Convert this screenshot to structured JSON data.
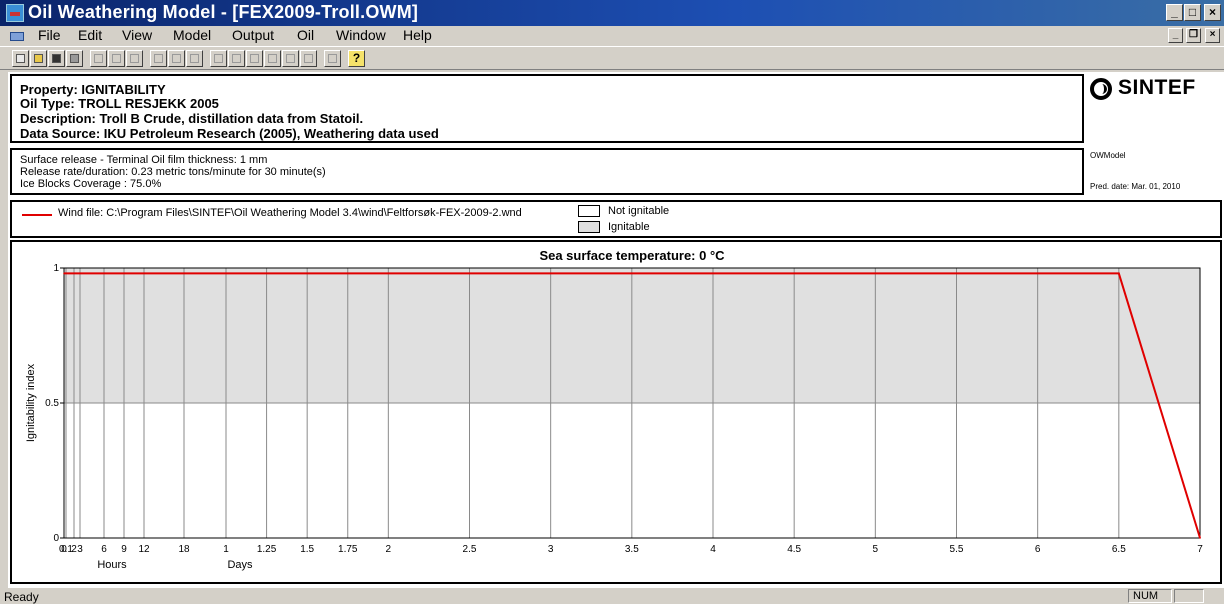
{
  "window": {
    "title": "Oil Weathering Model - [FEX2009-Troll.OWM]",
    "icon": "app-icon",
    "controls": {
      "minimize": "_",
      "maximize": "□",
      "close": "×"
    }
  },
  "menubar": {
    "items": [
      "File",
      "Edit",
      "View",
      "Model",
      "Output",
      "Oil",
      "Window",
      "Help"
    ],
    "mdi_controls": {
      "minimize": "_",
      "restore": "❐",
      "close": "×"
    }
  },
  "toolbar": {
    "buttons": [
      "new-icon",
      "open-icon",
      "save-icon",
      "print-icon",
      "cut-icon",
      "copy-icon",
      "paste-icon",
      "chart1-icon",
      "chart2-icon",
      "chart3-icon",
      "chart4-icon",
      "chart5-icon",
      "chart6-icon",
      "chart7-icon",
      "chart8-icon",
      "chart9-icon",
      "about-icon"
    ],
    "help_glyph": "?"
  },
  "header": {
    "property": "Property: IGNITABILITY",
    "oil_type": "Oil Type: TROLL RESJEKK 2005",
    "description": "Description: Troll  B Crude, distillation data from Statoil.",
    "data_source": "Data Source: IKU Petroleum Research (2005), Weathering data used",
    "brand": "SINTEF",
    "model_tag": "OWModel"
  },
  "release": {
    "line1": "Surface release - Terminal Oil film thickness: 1 mm",
    "line2": "Release rate/duration: 0.23 metric tons/minute for 30 minute(s)",
    "line3": " Ice Blocks Coverage : 75.0%",
    "pred_date": "Pred. date: Mar. 01, 2010"
  },
  "legend": {
    "wind_file": "Wind file: C:\\Program Files\\SINTEF\\Oil Weathering Model 3.4\\wind\\Feltforsøk-FEX-2009-2.wnd",
    "not_ignitable": "Not ignitable",
    "ignitable": "Ignitable",
    "line_color": "#e00000",
    "ignitable_color": "#e0e0e0"
  },
  "chart_data": {
    "type": "line",
    "title": "Sea surface temperature: 0 °C",
    "ylabel": "Ignitability index",
    "ylim": [
      0,
      1
    ],
    "y_ticks": [
      "0",
      "0.5",
      "1"
    ],
    "ignitable_band": [
      0.5,
      1
    ],
    "x_ticks_hours": [
      "0",
      "0.1",
      "2",
      "3",
      "6",
      "9",
      "12",
      "18"
    ],
    "x_ticks_days": [
      "1",
      "1.25",
      "1.5",
      "1.75",
      "2",
      "2.5",
      "3",
      "3.5",
      "4",
      "4.5",
      "5",
      "5.5",
      "6",
      "6.5",
      "7"
    ],
    "x_group_labels": [
      "Hours",
      "Days"
    ],
    "series": [
      {
        "x_days": [
          0,
          6.5,
          7
        ],
        "values": [
          0.98,
          0.98,
          0.0
        ]
      }
    ]
  },
  "statusbar": {
    "text": "Ready",
    "num": "NUM"
  }
}
